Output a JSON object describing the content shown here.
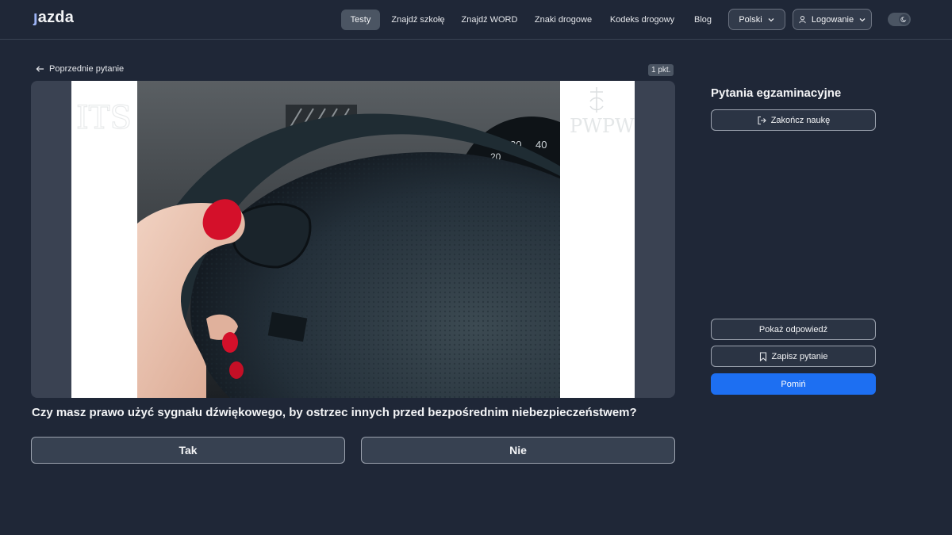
{
  "header": {
    "logo": "jazda",
    "nav": [
      {
        "label": "Testy",
        "active": true
      },
      {
        "label": "Znajdź szkołę",
        "active": false
      },
      {
        "label": "Znajdź WORD",
        "active": false
      },
      {
        "label": "Znaki drogowe",
        "active": false
      },
      {
        "label": "Kodeks drogowy",
        "active": false
      },
      {
        "label": "Blog",
        "active": false
      }
    ],
    "language": "Polski",
    "login": "Logowanie",
    "theme_icon": "moon-icon"
  },
  "main": {
    "back_label": "Poprzednie pytanie",
    "points": "1 pkt.",
    "watermark_left": "ITS",
    "watermark_right": "PWPW",
    "question": "Czy masz prawo użyć sygnału dźwiękowego, by ostrzec innych przed bezpośrednim niebezpieczeństwem?",
    "answers": [
      "Tak",
      "Nie"
    ]
  },
  "sidebar": {
    "title": "Pytania egzaminacyjne",
    "finish_label": "Zakończ naukę",
    "show_answer_label": "Pokaż odpowiedź",
    "save_label": "Zapisz pytanie",
    "skip_label": "Pomiń"
  },
  "colors": {
    "background": "#1f2737",
    "primary": "#1d6ff2"
  }
}
